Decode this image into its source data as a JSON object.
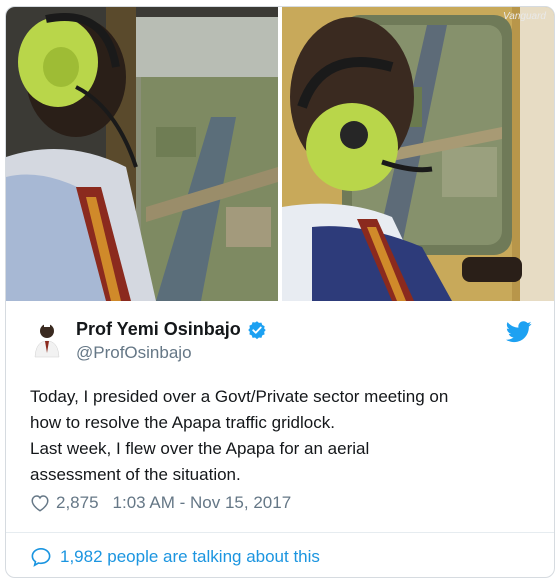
{
  "photos": {
    "left_alt": "aerial view photo 1",
    "right_alt": "aerial view photo 2",
    "watermark": "Vanguard"
  },
  "tweet": {
    "display_name": "Prof Yemi Osinbajo",
    "handle": "@ProfOsinbajo",
    "text_lines": [
      "Today, I presided over a Govt/Private sector meeting on",
      "how to resolve the Apapa traffic gridlock.",
      "Last week, I flew over the Apapa for an aerial",
      "assessment of the situation."
    ],
    "likes": "2,875",
    "timestamp": "1:03 AM - Nov 15, 2017",
    "talking": "1,982 people are talking about this"
  },
  "icons": {
    "verified": "verified-badge-icon",
    "bird": "twitter-bird-icon",
    "heart": "heart-icon",
    "bubble": "speech-bubble-icon"
  },
  "colors": {
    "twitter_blue": "#1da1f2",
    "text": "#14171a",
    "muted": "#657786",
    "link": "#1b95e0"
  }
}
